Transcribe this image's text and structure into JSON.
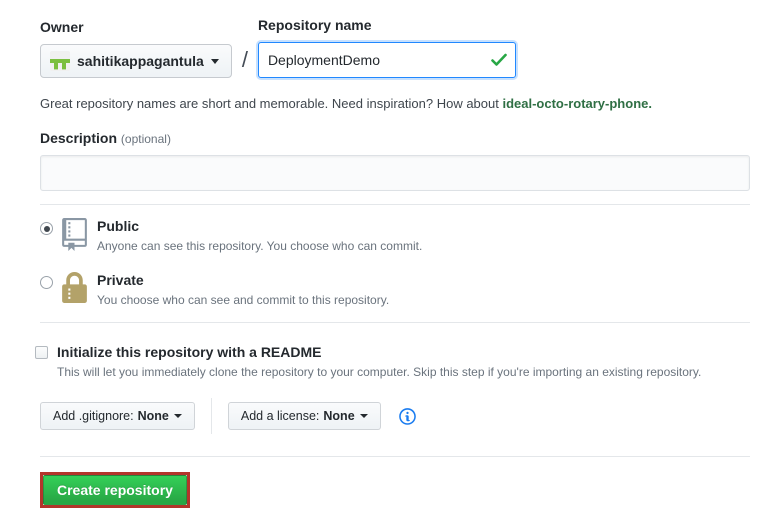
{
  "form": {
    "owner": {
      "label": "Owner",
      "value": "sahitikappagantula"
    },
    "separator": "/",
    "repo_name": {
      "label": "Repository name",
      "value": "DeploymentDemo",
      "valid": true
    },
    "hint": {
      "text": "Great repository names are short and memorable. Need inspiration? How about ",
      "suggestion": "ideal-octo-rotary-phone",
      "period": "."
    },
    "description": {
      "label": "Description",
      "optional": "(optional)",
      "value": ""
    },
    "visibility": [
      {
        "label": "Public",
        "desc": "Anyone can see this repository. You choose who can commit.",
        "selected": true
      },
      {
        "label": "Private",
        "desc": "You choose who can see and commit to this repository.",
        "selected": false
      }
    ],
    "readme": {
      "label": "Initialize this repository with a README",
      "desc": "This will let you immediately clone the repository to your computer. Skip this step if you're importing an existing repository.",
      "checked": false
    },
    "gitignore": {
      "prefix": "Add .gitignore:",
      "value": "None"
    },
    "license": {
      "prefix": "Add a license:",
      "value": "None"
    },
    "submit": {
      "label": "Create repository"
    }
  },
  "colors": {
    "focus_blue": "#2188ff",
    "success_green": "#28a745",
    "btn_green_top": "#34d058",
    "btn_green_bottom": "#28a745",
    "annotation_red": "#b3352b",
    "suggestion_green": "#2f6f44",
    "lock_gold": "#b3a269",
    "repo_icon_gray": "#8a97a4",
    "info_blue": "#1a7cf0"
  }
}
